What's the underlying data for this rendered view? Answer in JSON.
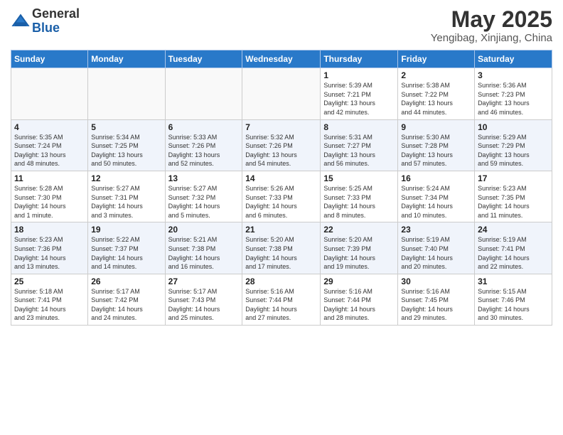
{
  "logo": {
    "general": "General",
    "blue": "Blue"
  },
  "title": "May 2025",
  "location": "Yengibag, Xinjiang, China",
  "weekdays": [
    "Sunday",
    "Monday",
    "Tuesday",
    "Wednesday",
    "Thursday",
    "Friday",
    "Saturday"
  ],
  "weeks": [
    [
      {
        "day": "",
        "info": ""
      },
      {
        "day": "",
        "info": ""
      },
      {
        "day": "",
        "info": ""
      },
      {
        "day": "",
        "info": ""
      },
      {
        "day": "1",
        "info": "Sunrise: 5:39 AM\nSunset: 7:21 PM\nDaylight: 13 hours\nand 42 minutes."
      },
      {
        "day": "2",
        "info": "Sunrise: 5:38 AM\nSunset: 7:22 PM\nDaylight: 13 hours\nand 44 minutes."
      },
      {
        "day": "3",
        "info": "Sunrise: 5:36 AM\nSunset: 7:23 PM\nDaylight: 13 hours\nand 46 minutes."
      }
    ],
    [
      {
        "day": "4",
        "info": "Sunrise: 5:35 AM\nSunset: 7:24 PM\nDaylight: 13 hours\nand 48 minutes."
      },
      {
        "day": "5",
        "info": "Sunrise: 5:34 AM\nSunset: 7:25 PM\nDaylight: 13 hours\nand 50 minutes."
      },
      {
        "day": "6",
        "info": "Sunrise: 5:33 AM\nSunset: 7:26 PM\nDaylight: 13 hours\nand 52 minutes."
      },
      {
        "day": "7",
        "info": "Sunrise: 5:32 AM\nSunset: 7:26 PM\nDaylight: 13 hours\nand 54 minutes."
      },
      {
        "day": "8",
        "info": "Sunrise: 5:31 AM\nSunset: 7:27 PM\nDaylight: 13 hours\nand 56 minutes."
      },
      {
        "day": "9",
        "info": "Sunrise: 5:30 AM\nSunset: 7:28 PM\nDaylight: 13 hours\nand 57 minutes."
      },
      {
        "day": "10",
        "info": "Sunrise: 5:29 AM\nSunset: 7:29 PM\nDaylight: 13 hours\nand 59 minutes."
      }
    ],
    [
      {
        "day": "11",
        "info": "Sunrise: 5:28 AM\nSunset: 7:30 PM\nDaylight: 14 hours\nand 1 minute."
      },
      {
        "day": "12",
        "info": "Sunrise: 5:27 AM\nSunset: 7:31 PM\nDaylight: 14 hours\nand 3 minutes."
      },
      {
        "day": "13",
        "info": "Sunrise: 5:27 AM\nSunset: 7:32 PM\nDaylight: 14 hours\nand 5 minutes."
      },
      {
        "day": "14",
        "info": "Sunrise: 5:26 AM\nSunset: 7:33 PM\nDaylight: 14 hours\nand 6 minutes."
      },
      {
        "day": "15",
        "info": "Sunrise: 5:25 AM\nSunset: 7:33 PM\nDaylight: 14 hours\nand 8 minutes."
      },
      {
        "day": "16",
        "info": "Sunrise: 5:24 AM\nSunset: 7:34 PM\nDaylight: 14 hours\nand 10 minutes."
      },
      {
        "day": "17",
        "info": "Sunrise: 5:23 AM\nSunset: 7:35 PM\nDaylight: 14 hours\nand 11 minutes."
      }
    ],
    [
      {
        "day": "18",
        "info": "Sunrise: 5:23 AM\nSunset: 7:36 PM\nDaylight: 14 hours\nand 13 minutes."
      },
      {
        "day": "19",
        "info": "Sunrise: 5:22 AM\nSunset: 7:37 PM\nDaylight: 14 hours\nand 14 minutes."
      },
      {
        "day": "20",
        "info": "Sunrise: 5:21 AM\nSunset: 7:38 PM\nDaylight: 14 hours\nand 16 minutes."
      },
      {
        "day": "21",
        "info": "Sunrise: 5:20 AM\nSunset: 7:38 PM\nDaylight: 14 hours\nand 17 minutes."
      },
      {
        "day": "22",
        "info": "Sunrise: 5:20 AM\nSunset: 7:39 PM\nDaylight: 14 hours\nand 19 minutes."
      },
      {
        "day": "23",
        "info": "Sunrise: 5:19 AM\nSunset: 7:40 PM\nDaylight: 14 hours\nand 20 minutes."
      },
      {
        "day": "24",
        "info": "Sunrise: 5:19 AM\nSunset: 7:41 PM\nDaylight: 14 hours\nand 22 minutes."
      }
    ],
    [
      {
        "day": "25",
        "info": "Sunrise: 5:18 AM\nSunset: 7:41 PM\nDaylight: 14 hours\nand 23 minutes."
      },
      {
        "day": "26",
        "info": "Sunrise: 5:17 AM\nSunset: 7:42 PM\nDaylight: 14 hours\nand 24 minutes."
      },
      {
        "day": "27",
        "info": "Sunrise: 5:17 AM\nSunset: 7:43 PM\nDaylight: 14 hours\nand 25 minutes."
      },
      {
        "day": "28",
        "info": "Sunrise: 5:16 AM\nSunset: 7:44 PM\nDaylight: 14 hours\nand 27 minutes."
      },
      {
        "day": "29",
        "info": "Sunrise: 5:16 AM\nSunset: 7:44 PM\nDaylight: 14 hours\nand 28 minutes."
      },
      {
        "day": "30",
        "info": "Sunrise: 5:16 AM\nSunset: 7:45 PM\nDaylight: 14 hours\nand 29 minutes."
      },
      {
        "day": "31",
        "info": "Sunrise: 5:15 AM\nSunset: 7:46 PM\nDaylight: 14 hours\nand 30 minutes."
      }
    ]
  ]
}
